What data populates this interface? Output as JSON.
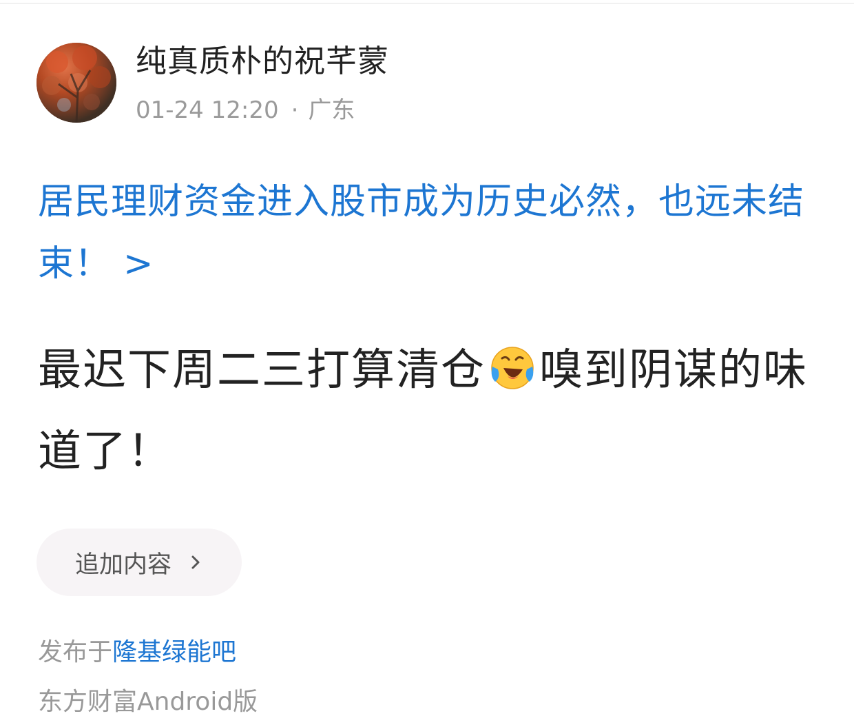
{
  "post": {
    "author_name": "纯真质朴的祝芊蒙",
    "timestamp": "01-24 12:20",
    "separator": "·",
    "location": "广东",
    "article_link_text": "居民理财资金进入股市成为历史必然，也远未结束！",
    "article_link_chevron": ">",
    "body_part1": "最迟下周二三打算清仓",
    "emoji": "laughing-crying-emoji",
    "body_part2": "嗅到阴谋的味道了！",
    "append_button_label": "追加内容",
    "posted_in_prefix": "发布于",
    "forum_name": "隆基绿能吧",
    "source_client": "东方财富Android版"
  },
  "colors": {
    "link_blue": "#1d76d2",
    "muted_gray": "#9a9a9a",
    "text_dark": "#222222",
    "button_bg": "#f7f4f6"
  }
}
